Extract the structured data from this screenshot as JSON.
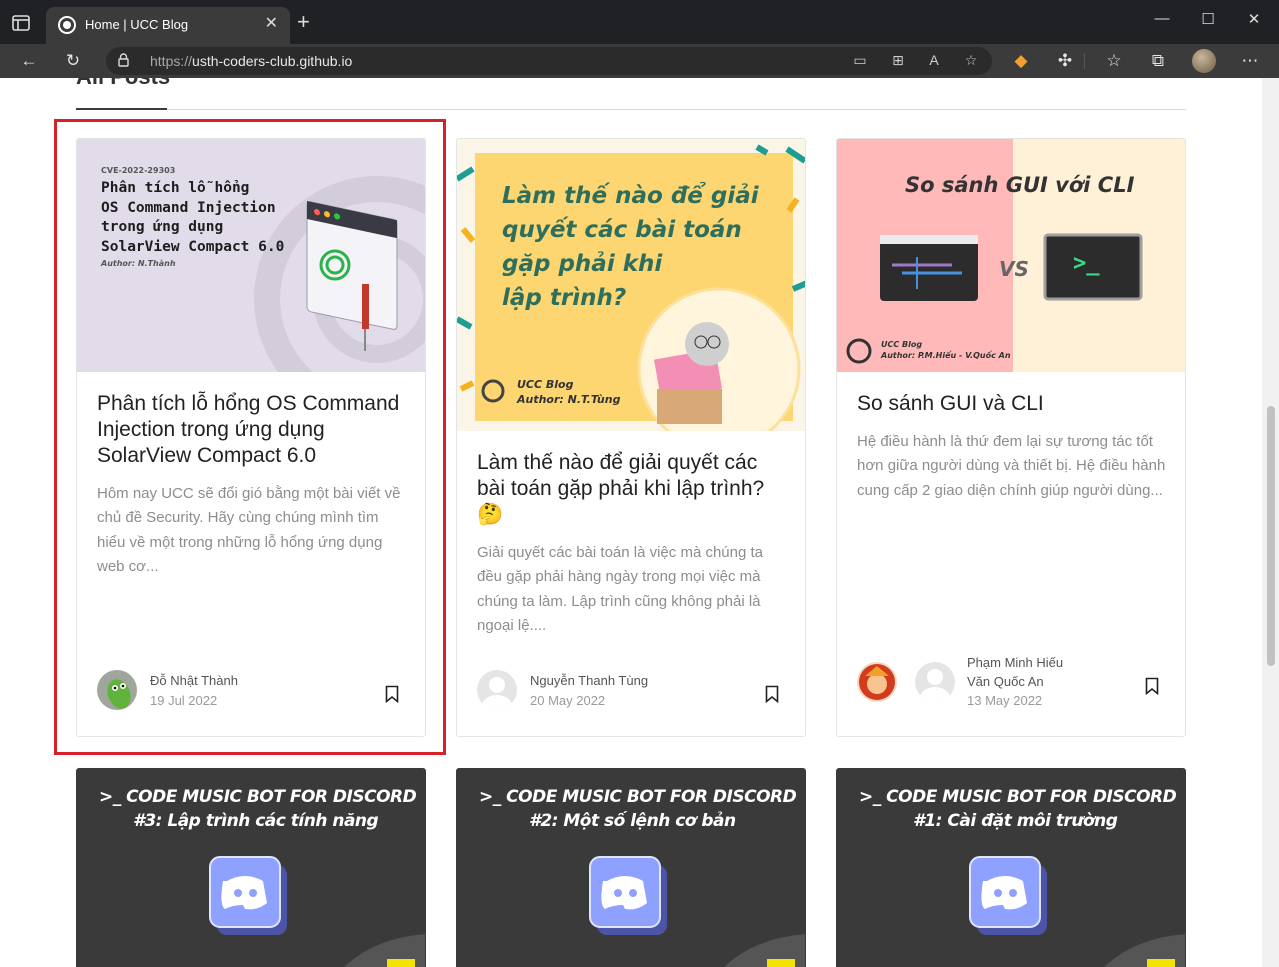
{
  "browser": {
    "tab_title": "Home | UCC Blog",
    "url_protocol": "https://",
    "url_host": "usth-coders-club.github.io"
  },
  "page": {
    "section_title": "All Posts"
  },
  "posts": [
    {
      "image": {
        "kicker": "CVE-2022-29303",
        "lines": [
          "Phân tích lỗ hổng",
          "OS Command Injection",
          "trong ứng dụng",
          "SolarView Compact 6.0"
        ],
        "author": "Author: N.Thành"
      },
      "title": "Phân tích lỗ hổng OS Command Injection trong ứng dụng SolarView Compact 6.0",
      "excerpt": "Hôm nay UCC sẽ đổi gió bằng một bài viết về chủ đề Security. Hãy cùng chúng mình tìm hiểu về một trong những lỗ hổng ứng dụng web cơ...",
      "author": "Đỗ Nhật Thành",
      "date": "19 Jul 2022"
    },
    {
      "image": {
        "lines": [
          "Làm thế nào để giải",
          "quyết các bài toán",
          "gặp phải khi",
          "lập trình?"
        ],
        "brand": "UCC Blog",
        "author": "Author: N.T.Tùng"
      },
      "title": "Làm thế nào để giải quyết các bài toán gặp phải khi lập trình?",
      "emoji": "🤔",
      "excerpt": "Giải quyết các bài toán là việc mà chúng ta đều gặp phải hàng ngày trong mọi việc mà chúng ta làm. Lập trình cũng không phải là ngoại lệ....",
      "author": "Nguyễn Thanh Tùng",
      "date": "20 May 2022"
    },
    {
      "image": {
        "headline": "So sánh GUI với CLI",
        "vs": "VS",
        "prompt": ">_",
        "brand": "UCC Blog",
        "author": "Author: P.M.Hiếu - V.Quốc An"
      },
      "title": "So sánh GUI và CLI",
      "excerpt": "Hệ điều hành là thứ đem lại sự tương tác tốt hơn giữa người dùng và thiết bị. Hệ điều hành cung cấp 2 giao diện chính giúp người dùng...",
      "authors": [
        "Phạm Minh Hiếu",
        "Văn Quốc An"
      ],
      "date": "13 May 2022"
    }
  ],
  "music_posts": [
    {
      "line1": ">_ CODE MUSIC BOT FOR DISCORD",
      "line2": "#3: Lập trình các tính năng"
    },
    {
      "line1": ">_ CODE MUSIC BOT FOR DISCORD",
      "line2": "#2: Một số lệnh cơ bản"
    },
    {
      "line1": ">_ CODE MUSIC BOT FOR DISCORD",
      "line2": "#1: Cài đặt môi trường"
    }
  ],
  "colors": {
    "highlight": "#d6202a",
    "card1_bg": "#e2dcea",
    "card2_bg": "#fdd571",
    "card3_pink": "#ffb9b9",
    "card3_cream": "#fff0d8",
    "music_bg": "#3b3a3a"
  }
}
